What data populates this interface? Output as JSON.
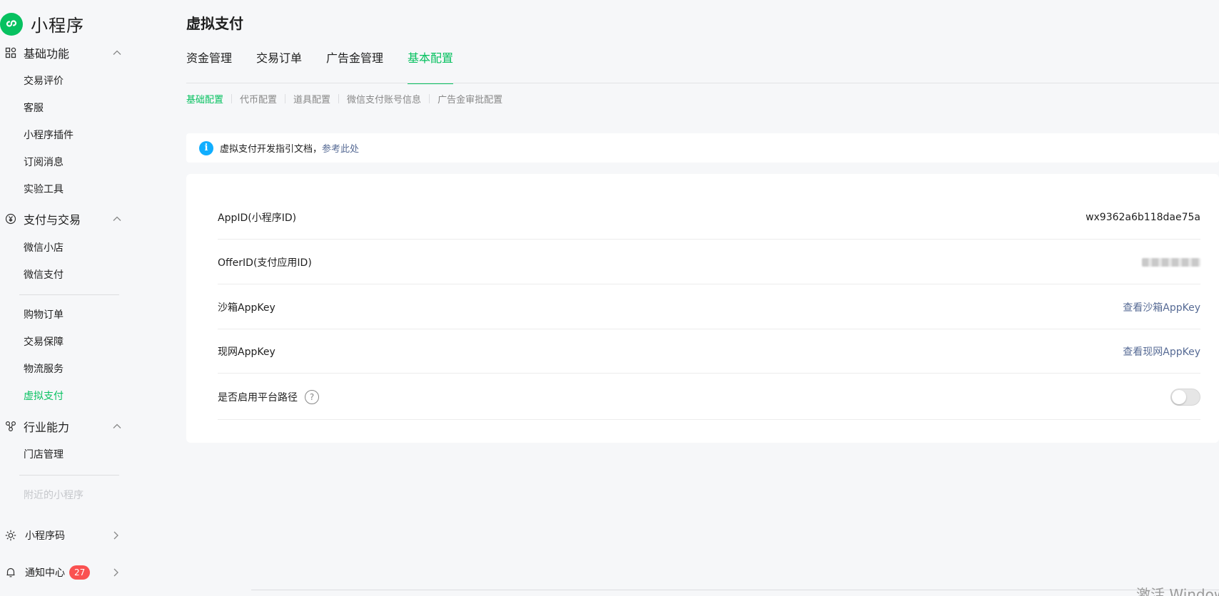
{
  "sidebar": {
    "logo_text": "小程序",
    "groups": [
      {
        "label": "基础功能",
        "icon": "grid-icon",
        "items": [
          "交易评价",
          "客服",
          "小程序插件",
          "订阅消息",
          "实验工具"
        ]
      },
      {
        "label": "支付与交易",
        "icon": "yuan-circle-icon",
        "items": [
          "微信小店",
          "微信支付",
          "购物订单",
          "交易保障",
          "物流服务",
          "虚拟支付"
        ],
        "active_item": "虚拟支付"
      },
      {
        "label": "行业能力",
        "icon": "nodes-icon",
        "items": [
          "门店管理",
          "附近的小程序"
        ],
        "disabled_item": "附近的小程序"
      }
    ],
    "bottom": [
      {
        "label": "小程序码",
        "icon": "sun-burst-icon"
      },
      {
        "label": "通知中心",
        "icon": "bell-icon",
        "badge": "27"
      }
    ]
  },
  "main": {
    "title": "虚拟支付",
    "tabs": [
      "资金管理",
      "交易订单",
      "广告金管理",
      "基本配置"
    ],
    "active_tab": "基本配置",
    "subtabs": [
      "基础配置",
      "代币配置",
      "道具配置",
      "微信支付账号信息",
      "广告金审批配置"
    ],
    "active_subtab": "基础配置",
    "notice": {
      "text": "虚拟支付开发指引文档，",
      "link": "参考此处"
    },
    "rows": [
      {
        "label": "AppID(小程序ID)",
        "value": "wx9362a6b118dae75a"
      },
      {
        "label": "OfferID(支付应用ID)"
      },
      {
        "label": "沙箱AppKey",
        "link": "查看沙箱AppKey"
      },
      {
        "label": "现网AppKey",
        "link": "查看现网AppKey"
      },
      {
        "label": "是否启用平台路径",
        "toggle_on": false
      }
    ],
    "help_glyph": "?",
    "info_glyph": "i"
  },
  "watermark": "激活 Windows",
  "colors": {
    "brand": "#07c160",
    "link": "#576b95",
    "badge": "#fa5151",
    "info": "#10aeff"
  }
}
